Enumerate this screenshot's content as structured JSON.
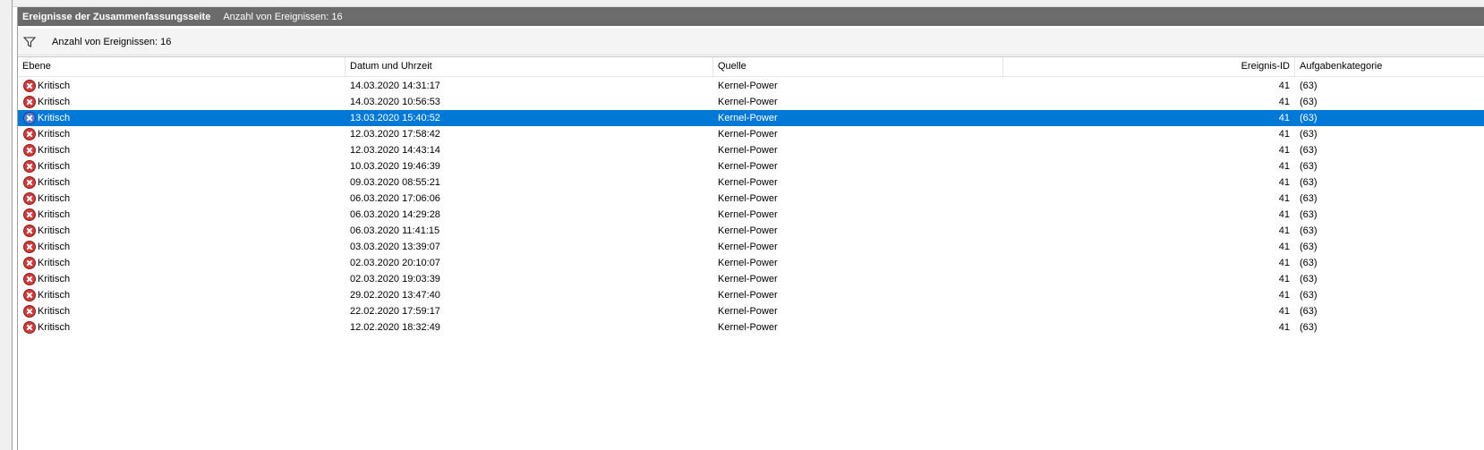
{
  "header": {
    "title": "Ereignisse der Zusammenfassungsseite",
    "count": "Anzahl von Ereignissen: 16"
  },
  "filter": {
    "icon": "filter-icon",
    "text": "Anzahl von Ereignissen: 16"
  },
  "columns": [
    "Ebene",
    "Datum und Uhrzeit",
    "Quelle",
    "Ereignis-ID",
    "Aufgabenkategorie"
  ],
  "colors": {
    "header_bg": "#6b6b6b",
    "selection": "#0078d7",
    "critical": "#d43a3a"
  },
  "selected_index": 2,
  "rows": [
    {
      "level": "Kritisch",
      "datetime": "14.03.2020 14:31:17",
      "source": "Kernel-Power",
      "event_id": "41",
      "category": "(63)"
    },
    {
      "level": "Kritisch",
      "datetime": "14.03.2020 10:56:53",
      "source": "Kernel-Power",
      "event_id": "41",
      "category": "(63)"
    },
    {
      "level": "Kritisch",
      "datetime": "13.03.2020 15:40:52",
      "source": "Kernel-Power",
      "event_id": "41",
      "category": "(63)"
    },
    {
      "level": "Kritisch",
      "datetime": "12.03.2020 17:58:42",
      "source": "Kernel-Power",
      "event_id": "41",
      "category": "(63)"
    },
    {
      "level": "Kritisch",
      "datetime": "12.03.2020 14:43:14",
      "source": "Kernel-Power",
      "event_id": "41",
      "category": "(63)"
    },
    {
      "level": "Kritisch",
      "datetime": "10.03.2020 19:46:39",
      "source": "Kernel-Power",
      "event_id": "41",
      "category": "(63)"
    },
    {
      "level": "Kritisch",
      "datetime": "09.03.2020 08:55:21",
      "source": "Kernel-Power",
      "event_id": "41",
      "category": "(63)"
    },
    {
      "level": "Kritisch",
      "datetime": "06.03.2020 17:06:06",
      "source": "Kernel-Power",
      "event_id": "41",
      "category": "(63)"
    },
    {
      "level": "Kritisch",
      "datetime": "06.03.2020 14:29:28",
      "source": "Kernel-Power",
      "event_id": "41",
      "category": "(63)"
    },
    {
      "level": "Kritisch",
      "datetime": "06.03.2020 11:41:15",
      "source": "Kernel-Power",
      "event_id": "41",
      "category": "(63)"
    },
    {
      "level": "Kritisch",
      "datetime": "03.03.2020 13:39:07",
      "source": "Kernel-Power",
      "event_id": "41",
      "category": "(63)"
    },
    {
      "level": "Kritisch",
      "datetime": "02.03.2020 20:10:07",
      "source": "Kernel-Power",
      "event_id": "41",
      "category": "(63)"
    },
    {
      "level": "Kritisch",
      "datetime": "02.03.2020 19:03:39",
      "source": "Kernel-Power",
      "event_id": "41",
      "category": "(63)"
    },
    {
      "level": "Kritisch",
      "datetime": "29.02.2020 13:47:40",
      "source": "Kernel-Power",
      "event_id": "41",
      "category": "(63)"
    },
    {
      "level": "Kritisch",
      "datetime": "22.02.2020 17:59:17",
      "source": "Kernel-Power",
      "event_id": "41",
      "category": "(63)"
    },
    {
      "level": "Kritisch",
      "datetime": "12.02.2020 18:32:49",
      "source": "Kernel-Power",
      "event_id": "41",
      "category": "(63)"
    }
  ]
}
